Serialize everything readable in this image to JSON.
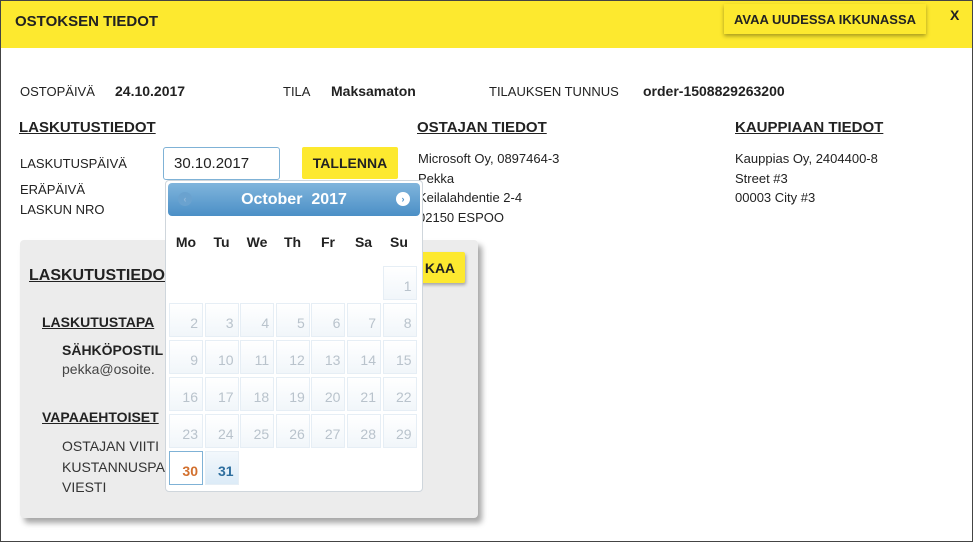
{
  "header": {
    "title": "OSTOKSEN TIEDOT",
    "open_new_window": "AVAA UUDESSA IKKUNASSA",
    "close": "X",
    "bg": "#fde92f"
  },
  "summary": {
    "purchase_date_label": "OSTOPÄIVÄ",
    "purchase_date": "24.10.2017",
    "status_label": "TILA",
    "status": "Maksamaton",
    "order_id_label": "TILAUKSEN TUNNUS",
    "order_id": "order-1508829263200"
  },
  "billing": {
    "heading": "LASKUTUSTIEDOT",
    "billing_date_label": "LASKUTUSPÄIVÄ",
    "billing_date_value": "30.10.2017",
    "save": "TALLENNA",
    "due_date_label": "ERÄPÄIVÄ",
    "invoice_no_label": "LASKUN NRO"
  },
  "buyer": {
    "heading": "OSTAJAN TIEDOT",
    "lines": [
      "Microsoft Oy, 0897464-3",
      "Pekka",
      "Keilalahdentie 2-4",
      "02150 ESPOO"
    ]
  },
  "merchant": {
    "heading": "KAUPPIAAN TIEDOT",
    "lines": [
      "Kauppias Oy, 2404400-8",
      "Street #3",
      "00003 City #3"
    ]
  },
  "card": {
    "heading": "LASKUTUSTIEDO",
    "edit_button": "KAA",
    "method_heading": "LASKUTUSTAPA",
    "method": "SÄHKÖPOSTIL",
    "email": "pekka@osoite.",
    "optional_heading": "VAPAAEHTOISET",
    "fields": [
      "OSTAJAN VIITI",
      "KUSTANNUSPA",
      "VIESTI"
    ]
  },
  "datepicker": {
    "month": "October",
    "year": "2017",
    "prev": "‹",
    "next": "›",
    "weekdays": [
      "Mo",
      "Tu",
      "We",
      "Th",
      "Fr",
      "Sa",
      "Su"
    ],
    "days": [
      "1",
      "2",
      "3",
      "4",
      "5",
      "6",
      "7",
      "8",
      "9",
      "10",
      "11",
      "12",
      "13",
      "14",
      "15",
      "16",
      "17",
      "18",
      "19",
      "20",
      "21",
      "22",
      "23",
      "24",
      "25",
      "26",
      "27",
      "28",
      "29",
      "30",
      "31"
    ],
    "first_weekday_index": 6,
    "selected": "30",
    "enabled": [
      "30",
      "31"
    ]
  }
}
